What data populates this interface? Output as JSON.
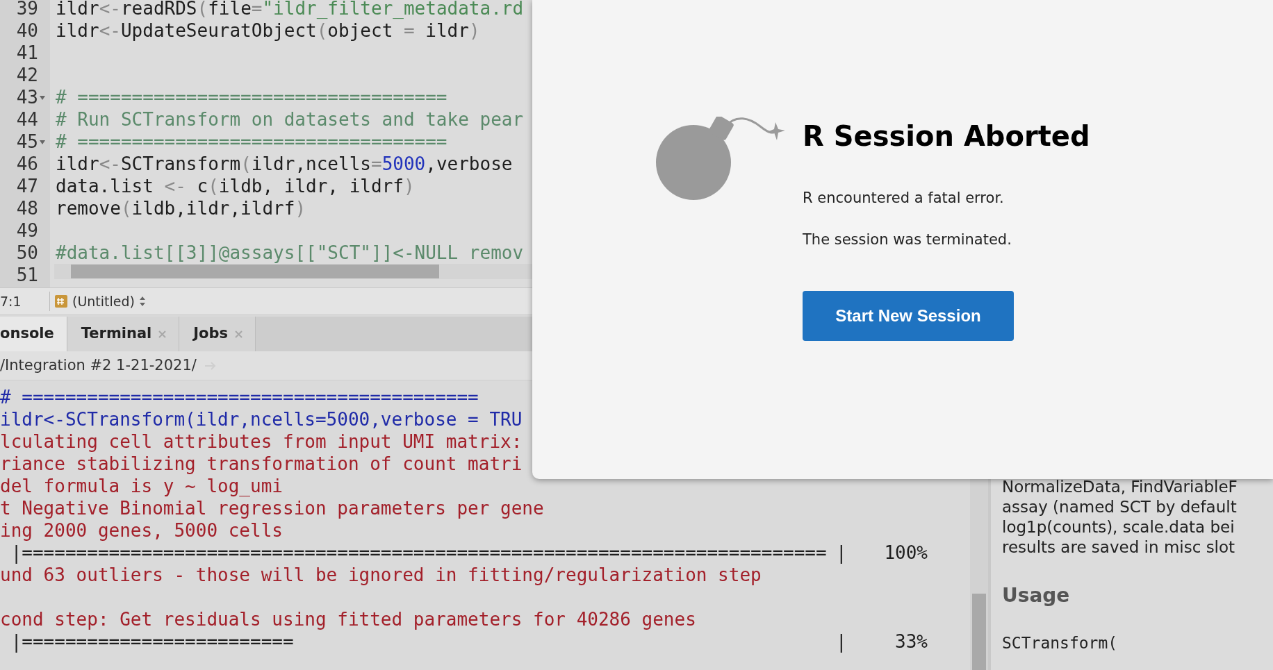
{
  "editor": {
    "lines": [
      {
        "number": "39",
        "fold": false,
        "tokens": [
          {
            "text": "ildr",
            "kind": "plain"
          },
          {
            "text": "<-",
            "kind": "op"
          },
          {
            "text": "readRDS",
            "kind": "plain"
          },
          {
            "text": "(",
            "kind": "op"
          },
          {
            "text": "file",
            "kind": "plain"
          },
          {
            "text": "=",
            "kind": "op"
          },
          {
            "text": "\"ildr_filter_metadata.rd",
            "kind": "string"
          }
        ]
      },
      {
        "number": "40",
        "fold": false,
        "tokens": [
          {
            "text": "ildr",
            "kind": "plain"
          },
          {
            "text": "<-",
            "kind": "op"
          },
          {
            "text": "UpdateSeuratObject",
            "kind": "plain"
          },
          {
            "text": "(",
            "kind": "op"
          },
          {
            "text": "object ",
            "kind": "plain"
          },
          {
            "text": "=",
            "kind": "op"
          },
          {
            "text": " ildr",
            "kind": "plain"
          },
          {
            "text": ")",
            "kind": "op"
          }
        ]
      },
      {
        "number": "41",
        "fold": false
      },
      {
        "number": "42",
        "fold": false
      },
      {
        "number": "43",
        "fold": true,
        "tokens": [
          {
            "text": "# ==================================",
            "kind": "comment"
          }
        ]
      },
      {
        "number": "44",
        "fold": false,
        "tokens": [
          {
            "text": "# Run SCTransform on datasets and take pear",
            "kind": "comment"
          }
        ]
      },
      {
        "number": "45",
        "fold": true,
        "tokens": [
          {
            "text": "# ==================================",
            "kind": "comment"
          }
        ]
      },
      {
        "number": "46",
        "fold": false,
        "tokens": [
          {
            "text": "ildr",
            "kind": "plain"
          },
          {
            "text": "<-",
            "kind": "op"
          },
          {
            "text": "SCTransform",
            "kind": "plain"
          },
          {
            "text": "(",
            "kind": "op"
          },
          {
            "text": "ildr,ncells",
            "kind": "plain"
          },
          {
            "text": "=",
            "kind": "op"
          },
          {
            "text": "5000",
            "kind": "number"
          },
          {
            "text": ",verbose",
            "kind": "plain"
          }
        ]
      },
      {
        "number": "47",
        "fold": false,
        "tokens": [
          {
            "text": "data.list ",
            "kind": "plain"
          },
          {
            "text": "<-",
            "kind": "op"
          },
          {
            "text": " c",
            "kind": "plain"
          },
          {
            "text": "(",
            "kind": "op"
          },
          {
            "text": "ildb, ildr, ildrf",
            "kind": "plain"
          },
          {
            "text": ")",
            "kind": "op"
          }
        ]
      },
      {
        "number": "48",
        "fold": false,
        "tokens": [
          {
            "text": "remove",
            "kind": "plain"
          },
          {
            "text": "(",
            "kind": "op"
          },
          {
            "text": "ildb,ildr,ildrf",
            "kind": "plain"
          },
          {
            "text": ")",
            "kind": "op"
          }
        ]
      },
      {
        "number": "49",
        "fold": false
      },
      {
        "number": "50",
        "fold": false,
        "tokens": [
          {
            "text": "#data.list[[3]]@assays[[\"SCT\"]]<-NULL remov",
            "kind": "comment"
          }
        ]
      },
      {
        "number": "51",
        "fold": false
      }
    ]
  },
  "status_bar": {
    "position": "7:1",
    "file": "(Untitled)"
  },
  "tabs": [
    {
      "label": "onsole",
      "selected": true,
      "closable": false
    },
    {
      "label": "Terminal",
      "selected": false,
      "closable": true
    },
    {
      "label": "Jobs",
      "selected": false,
      "closable": true
    }
  ],
  "console": {
    "path": "/Integration #2 1-21-2021/",
    "lines": [
      {
        "kind": "input",
        "text": "# =========================================="
      },
      {
        "kind": "input",
        "text": "ildr<-SCTransform(ildr,ncells=5000,verbose = TRU"
      },
      {
        "kind": "message",
        "text": "lculating cell attributes from input UMI matrix:"
      },
      {
        "kind": "message",
        "text": "riance stabilizing transformation of count matri"
      },
      {
        "kind": "message",
        "text": "del formula is y ~ log_umi"
      },
      {
        "kind": "message",
        "text": "t Negative Binomial regression parameters per gene"
      },
      {
        "kind": "message",
        "text": "ing 2000 genes, 5000 cells"
      },
      {
        "kind": "progress",
        "text": " |==========================================================================",
        "end": "|",
        "percent": "100%"
      },
      {
        "kind": "message",
        "text": "und 63 outliers - those will be ignored in fitting/regularization step"
      },
      {
        "kind": "blank"
      },
      {
        "kind": "message",
        "text": "cond step: Get residuals using fitted parameters for 40286 genes"
      },
      {
        "kind": "progress",
        "text": " |=========================",
        "end": "|",
        "percent": "33%"
      }
    ]
  },
  "help": {
    "paragraph_lines": [
      "NormalizeData, FindVariableF",
      "assay (named SCT by default",
      "log1p(counts), scale.data bei",
      "results are saved in misc slot"
    ],
    "heading": "Usage",
    "code": "SCTransform("
  },
  "dialog": {
    "title": "R Session Aborted",
    "messages": [
      "R encountered a fatal error.",
      "The session was terminated."
    ],
    "button": "Start New Session"
  }
}
